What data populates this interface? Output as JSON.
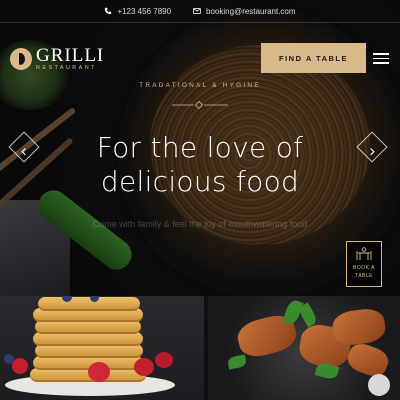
{
  "topbar": {
    "phone": "+123 456 7890",
    "email": "booking@restaurant.com"
  },
  "brand": {
    "name": "GRILLI",
    "subtitle": "RESTAURANT",
    "accent": "#d9b989"
  },
  "header": {
    "cta_label": "FIND A TABLE"
  },
  "hero": {
    "tagline": "TRADATIONAL & HYGINE",
    "headline_line1": "For the love of",
    "headline_line2": "delicious food",
    "subtext": "Come with family & feel the joy of mouthwatering food"
  },
  "book_badge": {
    "line1": "BOOK A",
    "line2": "TABLE"
  },
  "icons": [
    "phone-icon",
    "mail-icon",
    "menu-icon",
    "chevron-left-icon",
    "chevron-right-icon",
    "dining-table-icon"
  ]
}
